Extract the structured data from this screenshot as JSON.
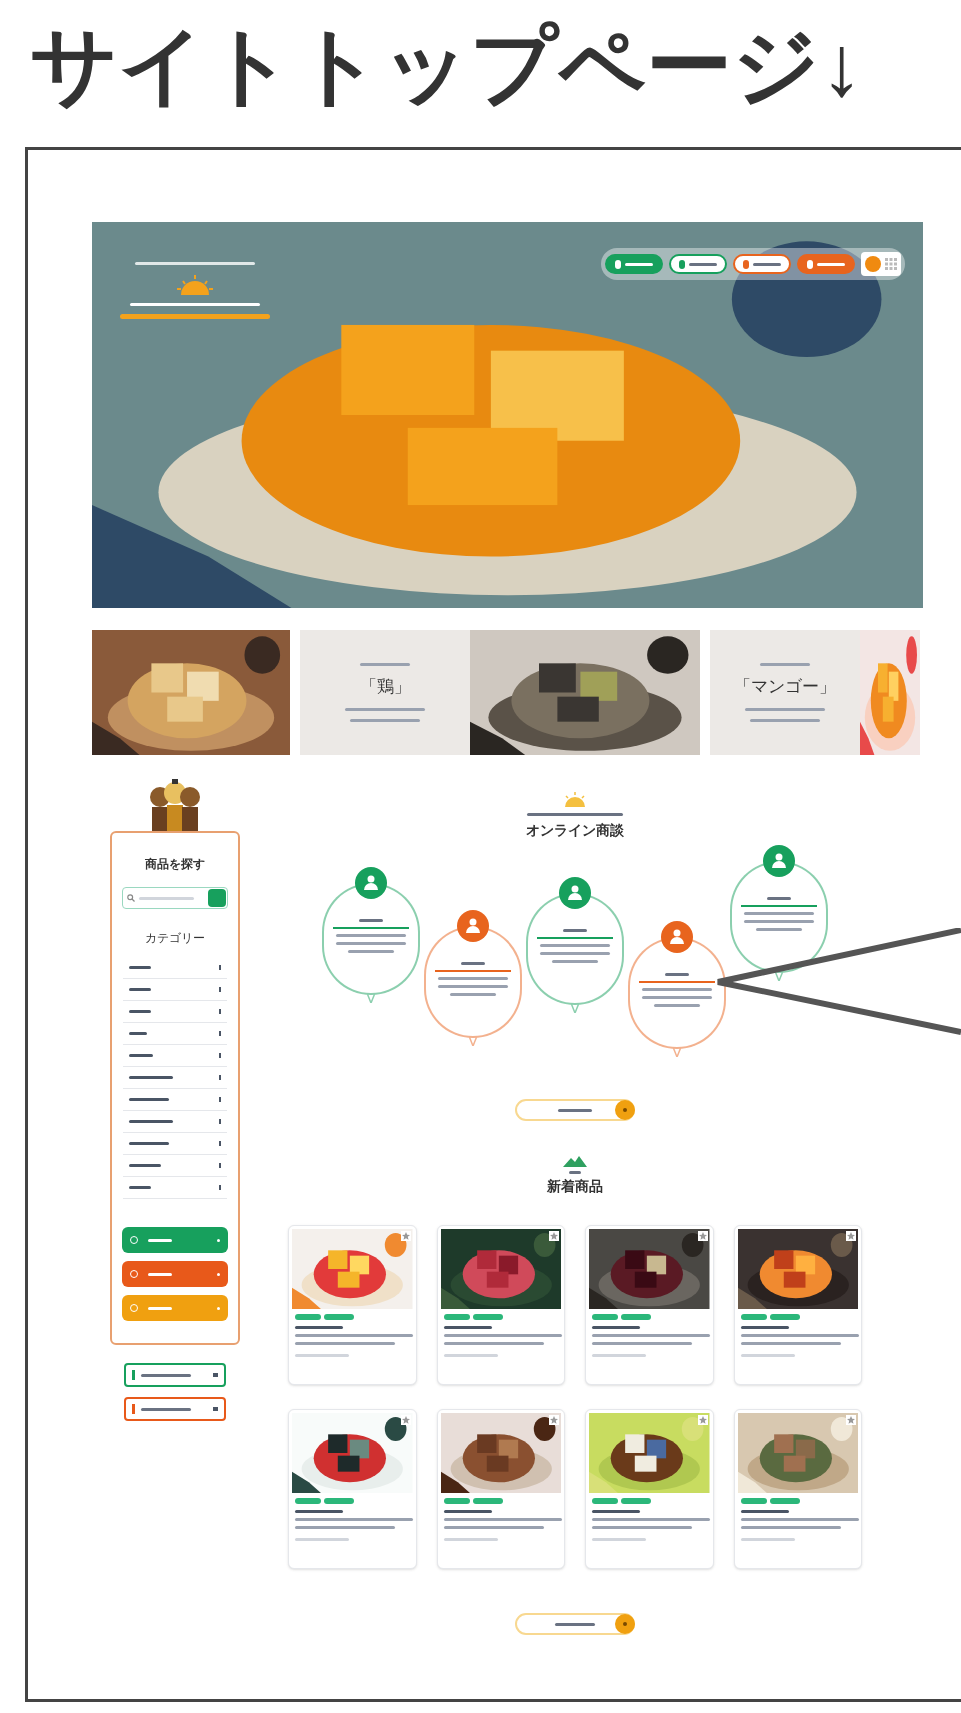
{
  "heading": "サイトトップページ↓",
  "hero": {
    "kind": "picture",
    "nav_buttons": [
      {
        "color": "#17a05d",
        "filled": true
      },
      {
        "color": "#17a05d",
        "filled": false
      },
      {
        "color": "#e8641e",
        "filled": false
      },
      {
        "color": "#e8641e",
        "filled": true
      }
    ]
  },
  "banners": [
    {
      "kind": "picture"
    },
    {
      "kind": "promo",
      "title": "「鶏」"
    },
    {
      "kind": "promo",
      "title": "「マンゴー」"
    }
  ],
  "sidebar": {
    "search_title": "商品を探す",
    "category_title": "カテゴリー",
    "buttons": [
      {
        "color": "#17a05d"
      },
      {
        "color": "#e8591a"
      },
      {
        "color": "#f0a010"
      }
    ],
    "links": [
      {
        "color": "#17a05d"
      },
      {
        "color": "#e8591a"
      }
    ]
  },
  "consultation": {
    "title": "オンライン商談",
    "consultants": [
      {
        "color": "#17a05d"
      },
      {
        "color": "#e8641e"
      },
      {
        "color": "#17a05d"
      },
      {
        "color": "#e8641e"
      },
      {
        "color": "#17a05d"
      }
    ]
  },
  "new_products": {
    "title": "新着商品",
    "products": [
      {
        "kind": "picture"
      },
      {
        "kind": "picture"
      },
      {
        "kind": "picture"
      },
      {
        "kind": "picture"
      },
      {
        "kind": "picture"
      },
      {
        "kind": "picture"
      },
      {
        "kind": "picture"
      },
      {
        "kind": "picture"
      }
    ]
  }
}
